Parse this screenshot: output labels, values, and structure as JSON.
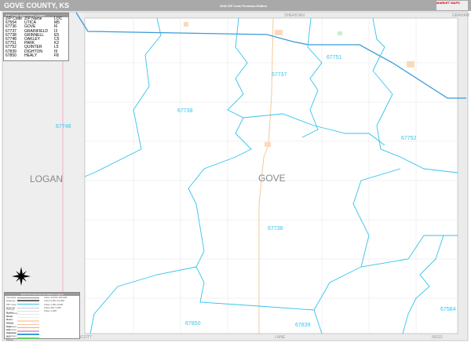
{
  "header": {
    "title": "GOVE COUNTY, KS",
    "edition": "2026 ZIP Code Premium Edition",
    "logo_text": "MARKET MAPS"
  },
  "zip_table": {
    "heading": "ZIP Code Index/Grid Locator",
    "columns": [
      "ZIP Code",
      "ZIP Name",
      "LOC"
    ],
    "rows": [
      [
        "67554",
        "UTICA",
        "M5"
      ],
      [
        "67736",
        "GOVE",
        "I6"
      ],
      [
        "67737",
        "GRAINFIELD",
        "I3"
      ],
      [
        "67738",
        "GRINNELL",
        "E5"
      ],
      [
        "67748",
        "OAKLEY",
        "C5"
      ],
      [
        "67751",
        "PARK",
        "K2"
      ],
      [
        "67752",
        "QUINTER",
        "L5"
      ],
      [
        "67839",
        "DIGHTON",
        "I9"
      ],
      [
        "67850",
        "HEALY",
        "F8"
      ]
    ]
  },
  "zip_labels": {
    "z67737": "67737",
    "z67731": "67751",
    "z67738": "67738",
    "z67748": "67748",
    "z67752": "67752",
    "z67736": "67736",
    "z67850": "67850",
    "z67839": "67839",
    "z67584": "67584"
  },
  "counties": {
    "main": "GOVE",
    "west": "LOGAN",
    "north": "SHERIDAN",
    "northeast": "GRAHAM",
    "south_w": "SCOTT",
    "south": "LANE",
    "southeast": "NESS"
  },
  "legend": {
    "heading": "2026 ZIP Code Premium Edition Legend",
    "items": [
      "Interstate",
      "Highway",
      "ZIP Code",
      "Railroad",
      "Primary Roads",
      "Secondary Roads",
      "Minor Roads",
      "Ref Places",
      "County Highways",
      "State Highways",
      "US Highways",
      "Interstate Highways",
      "Ref Places"
    ],
    "cities": [
      "Cities 10,001-100,000",
      "Cities 5,001-10,000",
      "Cities 1,001-5,000",
      "Cities 251-1,000",
      "Cities 1-250"
    ]
  },
  "colors": {
    "zip": "#33c3ec",
    "highway": "#3a9ad9",
    "road": "#f5c99a",
    "header": "#a9a9a9"
  }
}
